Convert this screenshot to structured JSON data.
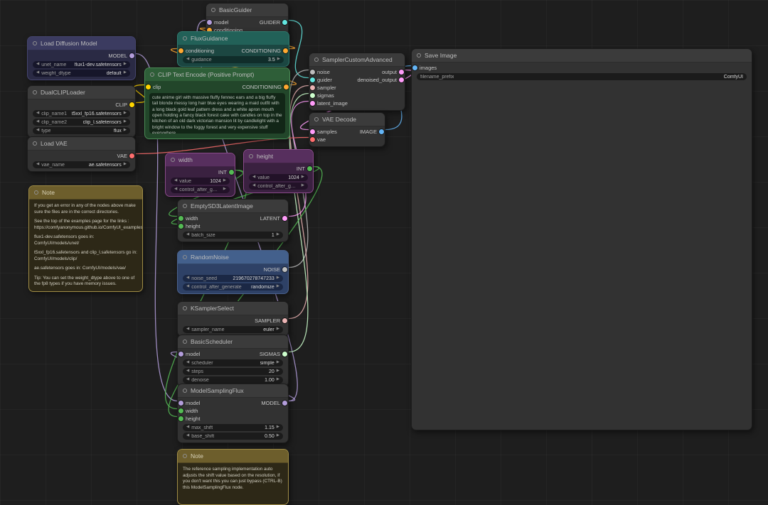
{
  "colors": {
    "model": "#b39ddb",
    "conditioning": "#ffa931",
    "clip": "#ffd500",
    "vae": "#ff6e6e",
    "latent": "#ff9cf9",
    "image": "#64b5f6",
    "guider": "#63e7e0",
    "noise": "#bdbdbd",
    "sampler": "#ecb4b4",
    "sigmas": "#cdffcd",
    "int": "#55bb55"
  },
  "nodes": {
    "basic_guider": {
      "title": "BasicGuider",
      "inputs": {
        "model": "model",
        "conditioning": "conditioning"
      },
      "outputs": {
        "guider": "GUIDER"
      }
    },
    "load_diffusion_model": {
      "title": "Load Diffusion Model",
      "outputs": {
        "model": "MODEL"
      },
      "widgets": {
        "unet_name": {
          "label": "unet_name",
          "value": "flux1-dev.safetensors"
        },
        "weight_dtype": {
          "label": "weight_dtype",
          "value": "default"
        }
      }
    },
    "flux_guidance": {
      "title": "FluxGuidance",
      "inputs": {
        "conditioning": "conditioning"
      },
      "outputs": {
        "conditioning": "CONDITIONING"
      },
      "widgets": {
        "guidance": {
          "label": "guidance",
          "value": "3.5"
        }
      }
    },
    "clip_text_encode": {
      "title": "CLIP Text Encode (Positive Prompt)",
      "inputs": {
        "clip": "clip"
      },
      "outputs": {
        "conditioning": "CONDITIONING"
      },
      "prompt": "cute anime girl with massive fluffy fennec ears and a big fluffy tail blonde messy long hair blue eyes wearing a maid outfit with a long black gold leaf pattern dress and a white apron mouth open holding a fancy black forest cake with candles on top in the kitchen of an old dark victorian mansion lit by candlelight with a bright window to the foggy forest and very expensive stuff everywhere"
    },
    "dual_clip_loader": {
      "title": "DualCLIPLoader",
      "outputs": {
        "clip": "CLIP"
      },
      "widgets": {
        "clip_name1": {
          "label": "clip_name1",
          "value": "t5xxl_fp16.safetensors"
        },
        "clip_name2": {
          "label": "clip_name2",
          "value": "clip_l.safetensors"
        },
        "type": {
          "label": "type",
          "value": "flux"
        }
      }
    },
    "load_vae": {
      "title": "Load VAE",
      "outputs": {
        "vae": "VAE"
      },
      "widgets": {
        "vae_name": {
          "label": "vae_name",
          "value": "ae.safetensors"
        }
      }
    },
    "note_left": {
      "title": "Note",
      "lines": [
        "If you get an error in any of the nodes above make sure the files are in the correct directories.",
        "See the top of the examples page for the links : https://comfyanonymous.github.io/ComfyUI_examples/flux/",
        "flux1-dev.safetensors goes in: ComfyUI/models/unet/",
        "t5xxl_fp16.safetensors and clip_l.safetensors go in: ComfyUI/models/clip/",
        "ae.safetensors goes in: ComfyUI/models/vae/",
        "Tip: You can set the weight_dtype above to one of the fp8 types if you have memory issues."
      ]
    },
    "sampler_custom_advanced": {
      "title": "SamplerCustomAdvanced",
      "inputs": {
        "noise": "noise",
        "guider": "guider",
        "sampler": "sampler",
        "sigmas": "sigmas",
        "latent_image": "latent_image"
      },
      "outputs": {
        "output": "output",
        "denoised_output": "denoised_output"
      }
    },
    "vae_decode": {
      "title": "VAE Decode",
      "inputs": {
        "samples": "samples",
        "vae": "vae"
      },
      "outputs": {
        "image": "IMAGE"
      }
    },
    "save_image": {
      "title": "Save Image",
      "inputs": {
        "images": "images"
      },
      "widgets": {
        "filename_prefix": {
          "label": "filename_prefix",
          "value": "ComfyUI"
        }
      }
    },
    "width": {
      "title": "width",
      "outputs": {
        "int": "INT"
      },
      "widgets": {
        "value": {
          "label": "value",
          "value": "1024"
        },
        "control_after_generate": {
          "label": "control_after_generate",
          "value": ""
        }
      }
    },
    "height": {
      "title": "height",
      "outputs": {
        "int": "INT"
      },
      "widgets": {
        "value": {
          "label": "value",
          "value": "1024"
        },
        "control_after_generate": {
          "label": "control_after_generate",
          "value": ""
        }
      }
    },
    "empty_sd3_latent_image": {
      "title": "EmptySD3LatentImage",
      "inputs": {
        "width": "width",
        "height": "height"
      },
      "outputs": {
        "latent": "LATENT"
      },
      "widgets": {
        "batch_size": {
          "label": "batch_size",
          "value": "1"
        }
      }
    },
    "random_noise": {
      "title": "RandomNoise",
      "outputs": {
        "noise": "NOISE"
      },
      "widgets": {
        "noise_seed": {
          "label": "noise_seed",
          "value": "219670278747233"
        },
        "control_after_generate": {
          "label": "control_after_generate",
          "value": "randomize"
        }
      }
    },
    "ksampler_select": {
      "title": "KSamplerSelect",
      "outputs": {
        "sampler": "SAMPLER"
      },
      "widgets": {
        "sampler_name": {
          "label": "sampler_name",
          "value": "euler"
        }
      }
    },
    "basic_scheduler": {
      "title": "BasicScheduler",
      "inputs": {
        "model": "model"
      },
      "outputs": {
        "sigmas": "SIGMAS"
      },
      "widgets": {
        "scheduler": {
          "label": "scheduler",
          "value": "simple"
        },
        "steps": {
          "label": "steps",
          "value": "20"
        },
        "denoise": {
          "label": "denoise",
          "value": "1.00"
        }
      }
    },
    "model_sampling_flux": {
      "title": "ModelSamplingFlux",
      "inputs": {
        "model": "model",
        "width": "width",
        "height": "height"
      },
      "outputs": {
        "model": "MODEL"
      },
      "widgets": {
        "max_shift": {
          "label": "max_shift",
          "value": "1.15"
        },
        "base_shift": {
          "label": "base_shift",
          "value": "0.50"
        }
      }
    },
    "note_bottom": {
      "title": "Note",
      "lines": [
        "The reference sampling implementation auto adjusts the shift value based on the resolution, if you don't want this you can just bypass (CTRL-B) this ModelSamplingFlux node."
      ]
    }
  }
}
